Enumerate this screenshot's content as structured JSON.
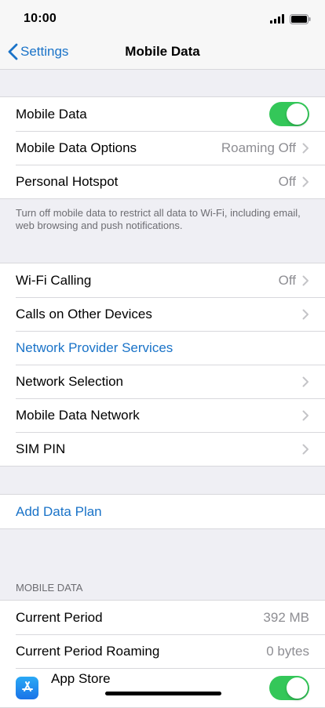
{
  "status_bar": {
    "time": "10:00"
  },
  "nav": {
    "back_label": "Settings",
    "title": "Mobile Data"
  },
  "group1": {
    "mobile_data": {
      "label": "Mobile Data",
      "on": true
    },
    "options": {
      "label": "Mobile Data Options",
      "value": "Roaming Off"
    },
    "hotspot": {
      "label": "Personal Hotspot",
      "value": "Off"
    },
    "footer": "Turn off mobile data to restrict all data to Wi-Fi, including email, web browsing and push notifications."
  },
  "group2": {
    "wifi_calling": {
      "label": "Wi-Fi Calling",
      "value": "Off"
    },
    "other_devices": {
      "label": "Calls on Other Devices"
    },
    "provider_services": {
      "label": "Network Provider Services"
    },
    "network_selection": {
      "label": "Network Selection"
    },
    "data_network": {
      "label": "Mobile Data Network"
    },
    "sim_pin": {
      "label": "SIM PIN"
    }
  },
  "group3": {
    "add_plan": {
      "label": "Add Data Plan"
    }
  },
  "usage": {
    "header": "MOBILE DATA",
    "current_period": {
      "label": "Current Period",
      "value": "392 MB"
    },
    "current_roaming": {
      "label": "Current Period Roaming",
      "value": "0 bytes"
    },
    "app_store": {
      "label": "App Store",
      "on": true
    }
  },
  "colors": {
    "accent": "#1a73c8",
    "toggle_on": "#34c759",
    "background": "#efeff4"
  }
}
